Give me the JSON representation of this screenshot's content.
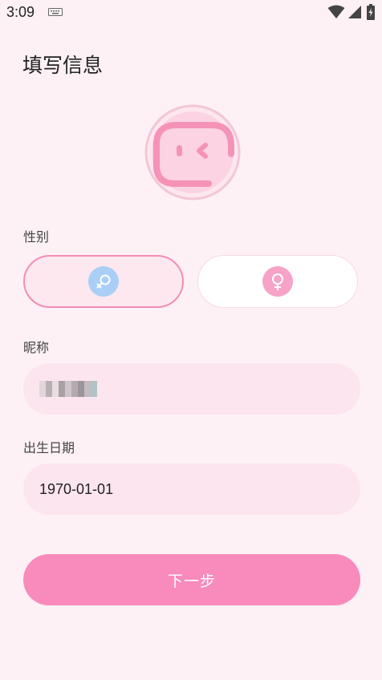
{
  "status_bar": {
    "time": "3:09",
    "icons": [
      "keyboard-icon",
      "wifi-icon",
      "signal-icon",
      "battery-icon"
    ]
  },
  "page": {
    "title": "填写信息"
  },
  "avatar": {
    "icon": "avatar-face-icon"
  },
  "gender": {
    "label": "性别",
    "options": [
      {
        "id": "male",
        "icon": "male-icon",
        "selected": true
      },
      {
        "id": "female",
        "icon": "female-icon",
        "selected": false
      }
    ]
  },
  "nickname": {
    "label": "昵称",
    "value_obscured": true
  },
  "birthdate": {
    "label": "出生日期",
    "value": "1970-01-01"
  },
  "actions": {
    "next_label": "下一步"
  },
  "colors": {
    "accent": "#f88bbc",
    "accent_border": "#f48cb7",
    "field_bg": "#fce5ee",
    "page_bg": "#fdf1f5",
    "male": "#a9cff7",
    "female": "#f7a2c7"
  }
}
